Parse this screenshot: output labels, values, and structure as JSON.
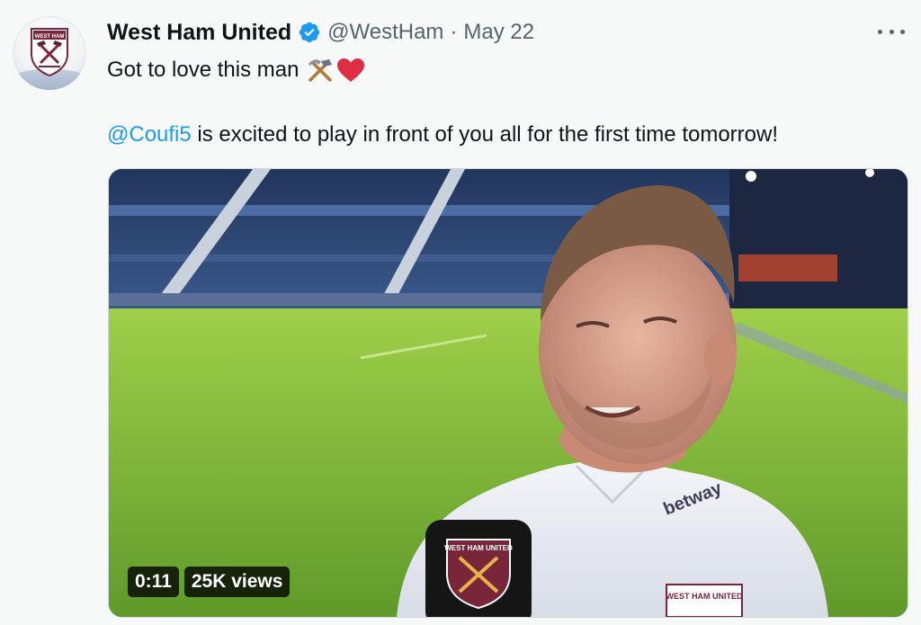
{
  "account": {
    "name": "West Ham United",
    "handle": "@WestHam",
    "separator": "·",
    "date": "May 22",
    "avatar_icon": "west-ham-crest-icon",
    "verified_icon": "verified-badge-icon"
  },
  "tweet": {
    "line1_text": "Got to love this man",
    "line1_emojis": [
      "hammer-and-pick-icon",
      "red-heart-icon"
    ],
    "mention": "@Coufi5",
    "line2_text": " is excited to play in front of you all for the first time tomorrow!"
  },
  "media": {
    "type": "video",
    "duration": "0:11",
    "views": "25K views",
    "shirt_sponsor": "betway",
    "badge_text": "WEST HAM UNITED",
    "mic_crest_text": "WEST HAM UNITED"
  },
  "colors": {
    "link": "#1d9bf0",
    "secondary_text": "#536471",
    "claret": "#7a263a",
    "background": "#f7f9f9"
  },
  "menu_icon": "more-options-icon"
}
